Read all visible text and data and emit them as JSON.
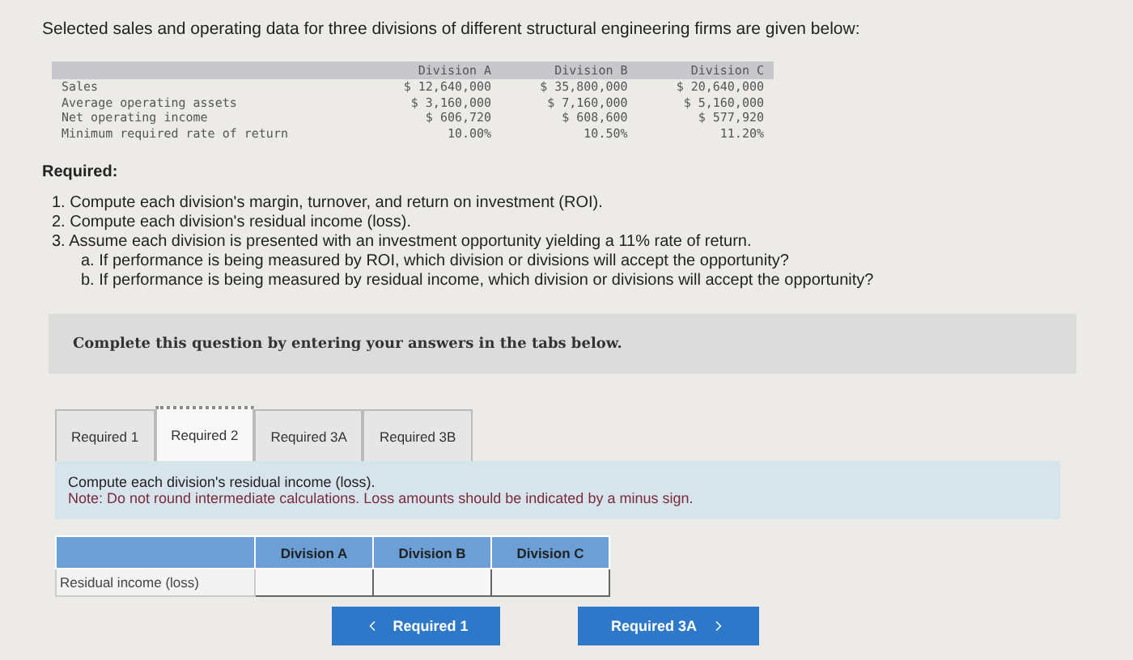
{
  "intro": "Selected sales and operating data for three divisions of different structural engineering firms are given below:",
  "data_table": {
    "columns": [
      "Division A",
      "Division B",
      "Division C"
    ],
    "rows": [
      {
        "label": "Sales",
        "values": [
          "$ 12,640,000",
          "$ 35,800,000",
          "$ 20,640,000"
        ]
      },
      {
        "label": "Average operating assets",
        "values": [
          "$ 3,160,000",
          "$ 7,160,000",
          "$ 5,160,000"
        ]
      },
      {
        "label": "Net operating income",
        "values": [
          "$ 606,720",
          "$ 608,600",
          "$ 577,920"
        ]
      },
      {
        "label": "Minimum required rate of return",
        "values": [
          "10.00%",
          "10.50%",
          "11.20%"
        ]
      }
    ]
  },
  "required": {
    "heading": "Required:",
    "items": [
      {
        "text": "1. Compute each division's margin, turnover, and return on investment (ROI)."
      },
      {
        "text": "2. Compute each division's residual income (loss)."
      },
      {
        "text": "3. Assume each division is presented with an investment opportunity yielding a 11% rate of return.",
        "children": [
          {
            "text": "a. If performance is being measured by ROI, which division or divisions will accept the opportunity?"
          },
          {
            "text": "b. If performance is being measured by residual income, which division or divisions will accept the opportunity?"
          }
        ]
      }
    ]
  },
  "prompt": "Complete this question by entering your answers in the tabs below.",
  "tabs": [
    {
      "label": "Required 1",
      "selected": false
    },
    {
      "label": "Required 2",
      "selected": true
    },
    {
      "label": "Required 3A",
      "selected": false
    },
    {
      "label": "Required 3B",
      "selected": false
    }
  ],
  "instructions": {
    "text": "Compute each division's residual income (loss).",
    "note": "Note: Do not round intermediate calculations. Loss amounts should be indicated by a minus sign."
  },
  "answer_table": {
    "columns": [
      "Division A",
      "Division B",
      "Division C"
    ],
    "rows": [
      {
        "label": "Residual income (loss)"
      }
    ]
  },
  "nav": {
    "previous": "Required 1",
    "next": "Required 3A"
  }
}
